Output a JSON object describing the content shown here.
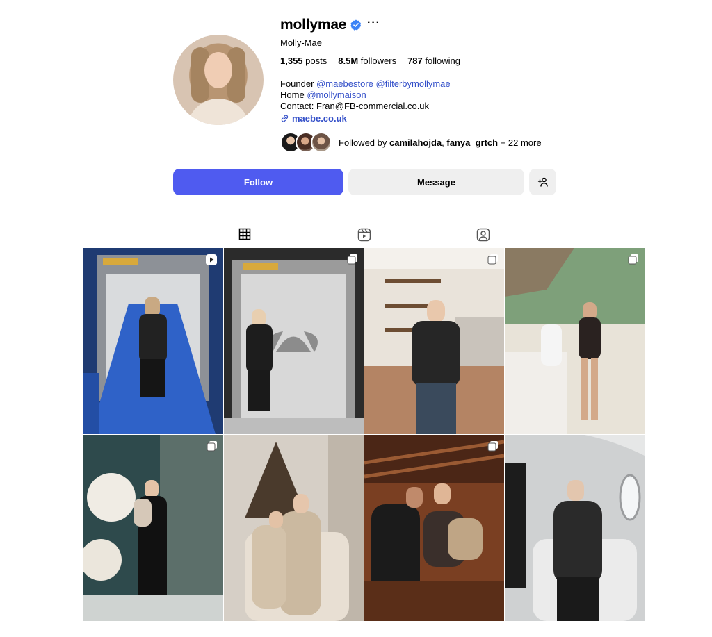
{
  "profile": {
    "username": "mollymae",
    "full_name": "Molly-Mae",
    "stats": {
      "posts_count": "1,355",
      "posts_label": "posts",
      "followers_count": "8.5M",
      "followers_label": "followers",
      "following_count": "787",
      "following_label": "following"
    },
    "bio": {
      "line1_prefix": "Founder",
      "line1_mention1": "@maebestore",
      "line1_mention2": "@filterbymollymae",
      "line2_prefix": "Home",
      "line2_mention": "@mollymaison",
      "line3": "Contact: Fran@FB-commercial.co.uk"
    },
    "link": "maebe.co.uk",
    "followed_by": {
      "prefix": "Followed by",
      "user1": "camilahojda",
      "user2": "fanya_grtch",
      "suffix": "+ 22 more"
    }
  },
  "actions": {
    "follow_label": "Follow",
    "message_label": "Message"
  },
  "tabs": [
    {
      "icon": "grid-icon",
      "active": true
    },
    {
      "icon": "reels-icon",
      "active": false
    },
    {
      "icon": "tagged-icon",
      "active": false
    }
  ],
  "colors": {
    "accent": "#4f5bf0",
    "link": "#3450c9",
    "verified": "#3b82f6",
    "button_gray": "#efefef"
  },
  "posts": [
    {
      "badge": "reel-icon"
    },
    {
      "badge": "carousel-icon"
    },
    {
      "badge": "carousel-icon"
    },
    {
      "badge": "carousel-icon"
    },
    {
      "badge": "carousel-icon"
    },
    {
      "badge": "none"
    },
    {
      "badge": "carousel-icon"
    },
    {
      "badge": "none"
    }
  ]
}
